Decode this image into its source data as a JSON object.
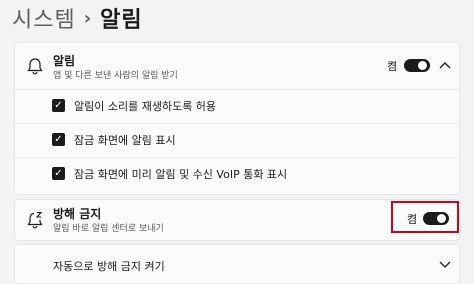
{
  "breadcrumb": {
    "parent": "시스템",
    "separator": "›",
    "current": "알림"
  },
  "notifications": {
    "title": "알림",
    "subtitle": "앱 및 다른 보낸 사람의 알림 받기",
    "state": "켬",
    "toggle_on": true,
    "icon": "bell-icon",
    "expand_icon": "chevron-up-icon",
    "options": [
      {
        "label": "알림이 소리를 재생하도록 허용",
        "checked": true
      },
      {
        "label": "잠금 화면에 알림 표시",
        "checked": true
      },
      {
        "label": "잠금 화면에 미리 알림 및 수신 VoIP 통화 표시",
        "checked": true
      }
    ]
  },
  "do_not_disturb": {
    "title": "방해 금지",
    "subtitle": "알림 바로 알림 센터로 보내기",
    "state": "켬",
    "toggle_on": true,
    "icon": "bell-snooze-icon",
    "highlight_color": "#d0021b"
  },
  "auto_dnd": {
    "title": "자동으로 방해 금지 켜기",
    "expand_icon": "chevron-down-icon"
  }
}
